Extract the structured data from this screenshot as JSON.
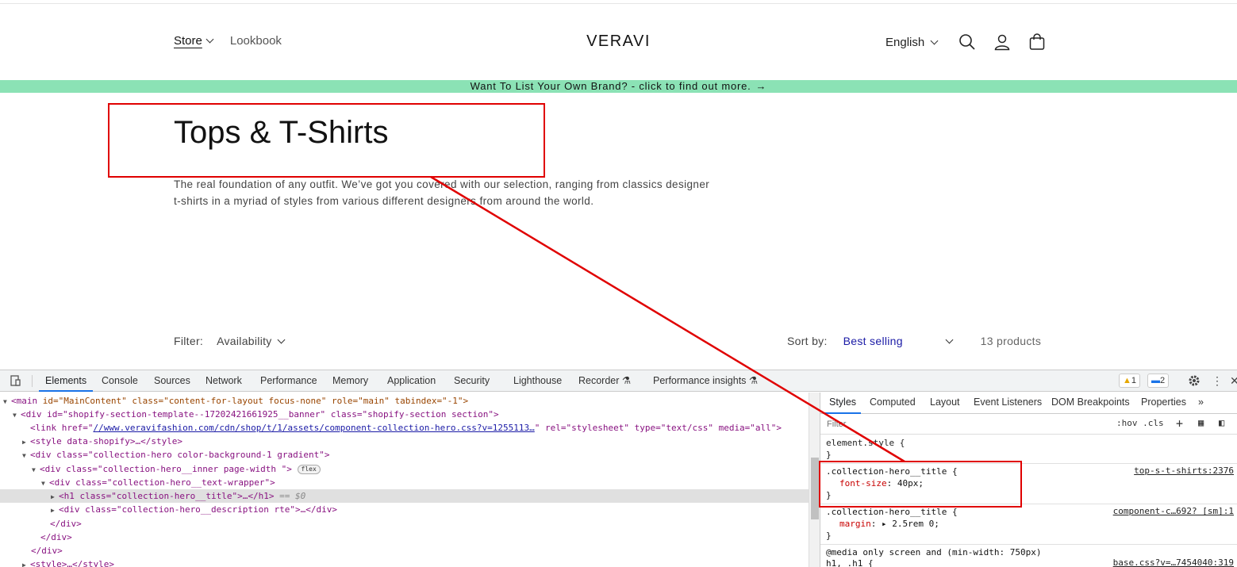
{
  "header": {
    "nav": [
      "Store",
      "Lookbook"
    ],
    "logo": "VERAVI",
    "language": "English",
    "icons": [
      "search-icon",
      "account-icon",
      "cart-icon"
    ]
  },
  "announcement": {
    "text": "Want To List Your Own Brand? - click to find out more.",
    "arrow": "→"
  },
  "hero": {
    "title": "Tops & T-Shirts",
    "description_line1": "The real foundation of any outfit. We’ve got you covered with our selection, ranging from classics designer",
    "description_line2": "t-shirts in a myriad of styles from various different designers from around the world."
  },
  "filter": {
    "label": "Filter:",
    "availability": "Availability"
  },
  "sort": {
    "label": "Sort by:",
    "value": "Best selling",
    "count": "13 products"
  },
  "devtools": {
    "tabs": [
      "Elements",
      "Console",
      "Sources",
      "Network",
      "Performance",
      "Memory",
      "Application",
      "Security",
      "Lighthouse",
      "Recorder",
      "Performance insights"
    ],
    "warnings": "1",
    "messages": "2",
    "dom": {
      "l1_tag": "<main",
      "l1_attrs": " id=\"MainContent\" class=\"content-for-layout focus-none\" role=\"main\" tabindex=\"-1\">",
      "l2": "<div id=\"shopify-section-template--17202421661925__banner\" class=\"shopify-section section\">",
      "l3_pre": "<link href=\"",
      "l3_link": "//www.veravifashion.com/cdn/shop/t/1/assets/component-collection-hero.css?v=1255113…",
      "l3_post": "\" rel=\"stylesheet\" type=\"text/css\" media=\"all\">",
      "l4": "<style data-shopify>…</style>",
      "l5": "<div class=\"collection-hero color-background-1 gradient\">",
      "l6": "<div class=\"collection-hero__inner page-width \">",
      "l6_pill": "flex",
      "l7": "<div class=\"collection-hero__text-wrapper\">",
      "l8": "<h1 class=\"collection-hero__title\">…</h1>",
      "l8_ref": "== $0",
      "l9": "<div class=\"collection-hero__description rte\">…</div>",
      "l10": "</div>",
      "l11": "</div>",
      "l12": "</div>",
      "l13": "<style>…</style>"
    },
    "styles_tabs": [
      "Styles",
      "Computed",
      "Layout",
      "Event Listeners",
      "DOM Breakpoints",
      "Properties",
      "»"
    ],
    "filter_placeholder": "Filter",
    "filter_tools": ":hov  .cls",
    "rules": {
      "element_style": "element.style {",
      "close": "}",
      "r1_selector": ".collection-hero__title {",
      "r1_prop": "font-size",
      "r1_value": ": 40px;",
      "r1_source": "top-s-t-shirts:2376",
      "r2_selector": ".collection-hero__title {",
      "r2_prop": "margin",
      "r2_value": ": ▸ 2.5rem 0;",
      "r2_source": "component-c…692? [sm]:1",
      "r3_media": "@media only screen and (min-width: 750px)",
      "r3_selector": "h1, .h1 {",
      "r3_source": "base.css?v=…7454040:319"
    }
  },
  "annotation_color": "#e00000"
}
